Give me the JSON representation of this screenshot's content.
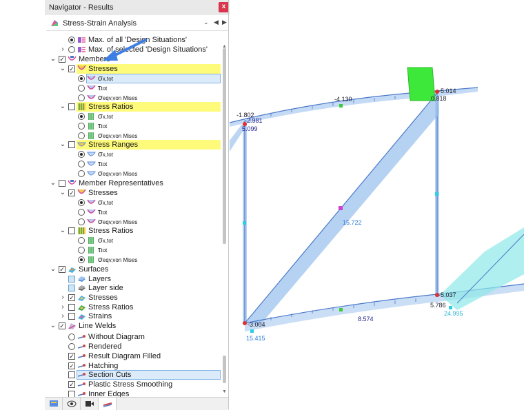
{
  "window": {
    "title": "Navigator - Results",
    "close_label": "x"
  },
  "combo": {
    "label": "Stress-Strain Analysis",
    "arrow": "⌄",
    "prev": "◀",
    "next": "▶"
  },
  "tree": [
    {
      "label": "Max. of all 'Design Situations'",
      "sub": "",
      "ctrl": "radio-on",
      "icon": "design-situation-icon"
    },
    {
      "label": "Max. of selected 'Design Situations'",
      "sub": "",
      "ctrl": "radio-off",
      "icon": "design-situation-icon"
    },
    {
      "label": "Members",
      "sub": "",
      "ctrl": "check-on",
      "icon": "member-icon"
    },
    {
      "label": "Stresses",
      "sub": "",
      "ctrl": "check-on",
      "icon": "stress-icon"
    },
    {
      "label": "σ",
      "sub": "x,tot",
      "ctrl": "radio-on",
      "icon": "stress-diagram-icon"
    },
    {
      "label": "τ",
      "sub": "tot",
      "ctrl": "radio-off",
      "icon": "stress-diagram-icon"
    },
    {
      "label": "σ",
      "sub": "eqv,von Mises",
      "ctrl": "radio-off",
      "icon": "stress-diagram-icon"
    },
    {
      "label": "Stress Ratios",
      "sub": "",
      "ctrl": "check-off",
      "icon": "stress-ratio-icon"
    },
    {
      "label": "σ",
      "sub": "x,tot",
      "ctrl": "radio-on",
      "icon": "stress-ratio-icon"
    },
    {
      "label": "τ",
      "sub": "tot",
      "ctrl": "radio-off",
      "icon": "stress-ratio-icon"
    },
    {
      "label": "σ",
      "sub": "eqv,von Mises",
      "ctrl": "radio-off",
      "icon": "stress-ratio-icon"
    },
    {
      "label": "Stress Ranges",
      "sub": "",
      "ctrl": "check-off",
      "icon": "stress-range-icon"
    },
    {
      "label": "σ",
      "sub": "x,tot",
      "ctrl": "radio-on",
      "icon": "stress-range-icon"
    },
    {
      "label": "τ",
      "sub": "tot",
      "ctrl": "radio-off",
      "icon": "stress-range-icon"
    },
    {
      "label": "σ",
      "sub": "eqv,von Mises",
      "ctrl": "radio-off",
      "icon": "stress-range-icon"
    },
    {
      "label": "Member Representatives",
      "sub": "",
      "ctrl": "check-off",
      "icon": "member-icon"
    },
    {
      "label": "Stresses",
      "sub": "",
      "ctrl": "check-on",
      "icon": "stress-icon"
    },
    {
      "label": "σ",
      "sub": "x,tot",
      "ctrl": "radio-on",
      "icon": "stress-diagram-icon"
    },
    {
      "label": "τ",
      "sub": "tot",
      "ctrl": "radio-off",
      "icon": "stress-diagram-icon"
    },
    {
      "label": "σ",
      "sub": "eqv,von Mises",
      "ctrl": "radio-off",
      "icon": "stress-diagram-icon"
    },
    {
      "label": "Stress Ratios",
      "sub": "",
      "ctrl": "check-off",
      "icon": "stress-ratio-icon"
    },
    {
      "label": "σ",
      "sub": "x,tot",
      "ctrl": "radio-off",
      "icon": "stress-ratio-icon"
    },
    {
      "label": "τ",
      "sub": "tot",
      "ctrl": "radio-off",
      "icon": "stress-ratio-icon"
    },
    {
      "label": "σ",
      "sub": "eqv,von Mises",
      "ctrl": "radio-on",
      "icon": "stress-ratio-icon"
    },
    {
      "label": "Surfaces",
      "sub": "",
      "ctrl": "check-on",
      "icon": "surface-icon"
    },
    {
      "label": "Layers",
      "sub": "",
      "ctrl": "check-fill",
      "icon": "layer-icon"
    },
    {
      "label": "Layer side",
      "sub": "",
      "ctrl": "check-fill",
      "icon": "layer-side-icon"
    },
    {
      "label": "Stresses",
      "sub": "",
      "ctrl": "check-on",
      "icon": "surface-stress-icon"
    },
    {
      "label": "Stress Ratios",
      "sub": "",
      "ctrl": "check-off",
      "icon": "surface-stress-icon"
    },
    {
      "label": "Strains",
      "sub": "",
      "ctrl": "check-off",
      "icon": "surface-stress-icon"
    },
    {
      "label": "Line Welds",
      "sub": "",
      "ctrl": "check-on",
      "icon": "line-weld-icon"
    },
    {
      "label": "Without Diagram",
      "sub": "",
      "ctrl": "radio-off",
      "icon": "weld-option-icon"
    },
    {
      "label": "Rendered",
      "sub": "",
      "ctrl": "radio-off",
      "icon": "weld-option-icon"
    },
    {
      "label": "Result Diagram Filled",
      "sub": "",
      "ctrl": "check-on",
      "icon": "weld-option-icon"
    },
    {
      "label": "Hatching",
      "sub": "",
      "ctrl": "check-on",
      "icon": "weld-option-icon"
    },
    {
      "label": "Section Cuts",
      "sub": "",
      "ctrl": "check-off",
      "icon": "weld-option-icon"
    },
    {
      "label": "Plastic Stress Smoothing",
      "sub": "",
      "ctrl": "check-on",
      "icon": "weld-option-icon"
    },
    {
      "label": "Inner Edges",
      "sub": "",
      "ctrl": "check-off",
      "icon": "weld-option-icon"
    }
  ],
  "bottom_tabs": [
    {
      "icon": "data-icon"
    },
    {
      "icon": "eye-icon"
    },
    {
      "icon": "video-icon"
    },
    {
      "icon": "results-icon"
    }
  ],
  "model_labels": {
    "top_left_a": "-1.802",
    "top_left_b": "-2.981",
    "top_left_c": "5.099",
    "top_mid": "-4.130",
    "top_right_a": "-5.014",
    "top_right_b": "0.818",
    "diag_mid": "15.722",
    "bot_left_a": "-3.004",
    "bot_left_b": "15.415",
    "bot_mid": "8.574",
    "bot_right_a": "-5.037",
    "bot_right_b": "5.786",
    "bot_right_c": "24.995"
  },
  "colors": {
    "highlight_yellow": "#fffb7a",
    "member_blue": "#9ec3ee",
    "plate_green": "#3ee83a",
    "arrow_blue": "#3e7fe6",
    "close_red": "#d9354c"
  }
}
